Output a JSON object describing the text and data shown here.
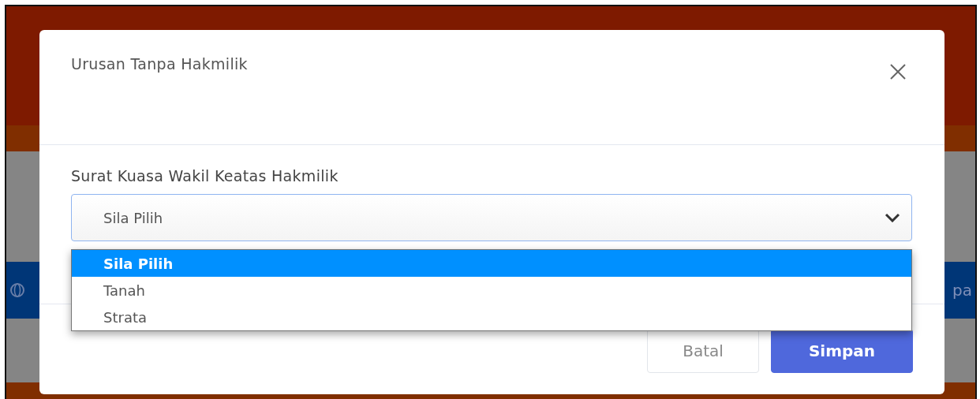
{
  "background": {
    "banner_text": "pa"
  },
  "dialog": {
    "title": "Urusan Tanpa Hakmilik",
    "field": {
      "label": "Surat Kuasa Wakil Keatas Hakmilik",
      "value": "Sila Pilih",
      "expanded": true,
      "options": [
        {
          "label": "Sila Pilih",
          "selected": true
        },
        {
          "label": "Tanah",
          "selected": false
        },
        {
          "label": "Strata",
          "selected": false
        }
      ]
    },
    "buttons": [
      {
        "label": "Batal",
        "kind": "secondary"
      },
      {
        "label": "Simpan",
        "kind": "primary"
      }
    ]
  }
}
